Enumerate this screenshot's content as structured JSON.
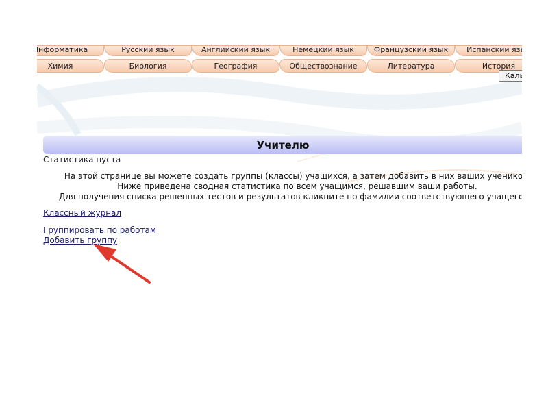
{
  "nav": {
    "row1": [
      "Информатика",
      "Русский язык",
      "Английский язык",
      "Немецкий язык",
      "Французский язык",
      "Испанский язык"
    ],
    "row2": [
      "Химия",
      "Биология",
      "География",
      "Обществознание",
      "Литература",
      "История"
    ],
    "calendar_button": "Каль"
  },
  "main": {
    "title": "Учителю",
    "stats_empty": "Статистика пуста",
    "info_lines": [
      "На этой странице вы можете создать группы (классы) учащихся, а затем добавить в них ваших учеников.",
      "Ниже приведена сводная статистика по всем учащимся, решавшим ваши работы.",
      "Для получения списка решенных тестов и результатов кликните по фамилии соответствующего учащегося."
    ],
    "links": {
      "class_journal": "Классный журнал",
      "group_by_works": "Группировать по работам",
      "add_group": "Добавить группу"
    }
  },
  "colors": {
    "tab_fill": "#f7c9aa",
    "header_fill": "#b9bdf3",
    "link": "#1a1a66",
    "annotation_arrow": "#e03a2f"
  }
}
